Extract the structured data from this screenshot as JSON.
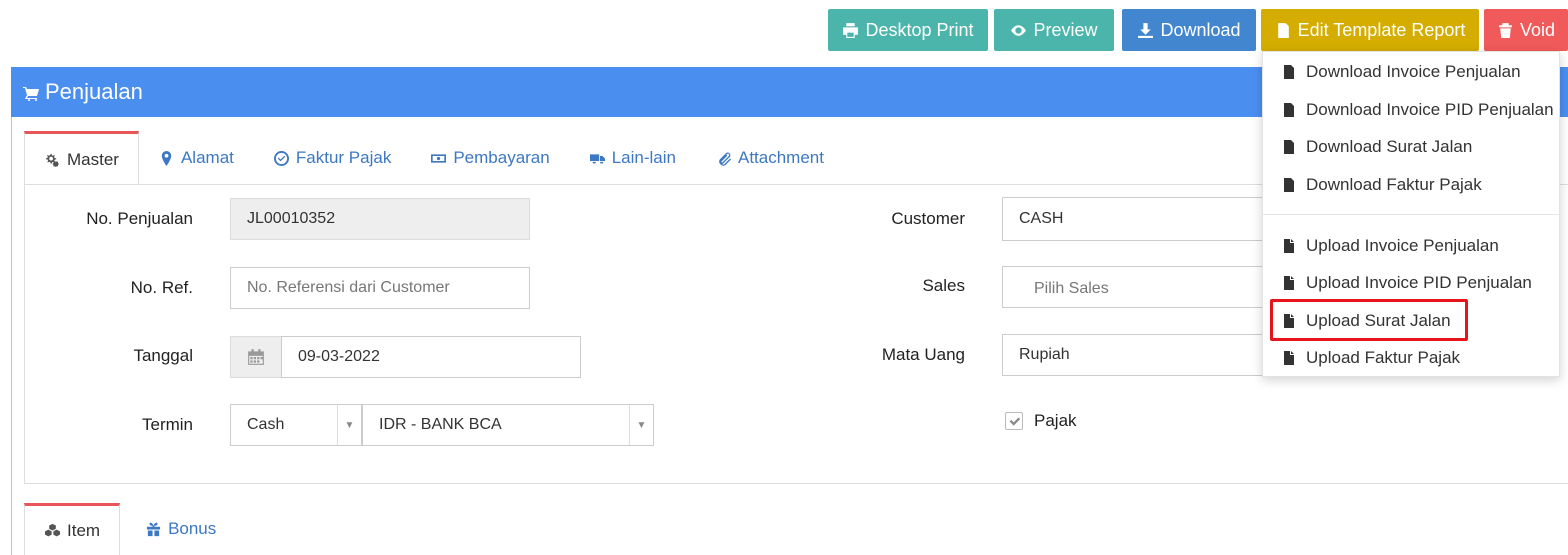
{
  "toolbar": {
    "desktop_print": "Desktop Print",
    "preview": "Preview",
    "download": "Download",
    "edit_template": "Edit Template Report",
    "void": "Void"
  },
  "panel": {
    "title": "Penjualan"
  },
  "tabs": [
    {
      "label": "Master",
      "icon": "gears-icon"
    },
    {
      "label": "Alamat",
      "icon": "map-marker-icon"
    },
    {
      "label": "Faktur Pajak",
      "icon": "check-circle-icon"
    },
    {
      "label": "Pembayaran",
      "icon": "money-icon"
    },
    {
      "label": "Lain-lain",
      "icon": "truck-icon"
    },
    {
      "label": "Attachment",
      "icon": "paperclip-icon"
    }
  ],
  "form": {
    "no_penjualan_label": "No. Penjualan",
    "no_penjualan_value": "JL00010352",
    "no_ref_label": "No. Ref.",
    "no_ref_placeholder": "No. Referensi dari Customer",
    "tanggal_label": "Tanggal",
    "tanggal_value": "09-03-2022",
    "termin_label": "Termin",
    "termin_value": "Cash",
    "bank_value": "IDR - BANK BCA",
    "customer_label": "Customer",
    "customer_value": "CASH",
    "sales_label": "Sales",
    "sales_placeholder": "Pilih Sales",
    "mata_uang_label": "Mata Uang",
    "mata_uang_value": "Rupiah",
    "pajak_label": "Pajak"
  },
  "bottom_tabs": [
    {
      "label": "Item",
      "icon": "cubes-icon"
    },
    {
      "label": "Bonus",
      "icon": "gift-icon"
    }
  ],
  "dropdown": {
    "download_items": [
      "Download Invoice Penjualan",
      "Download Invoice PID Penjualan",
      "Download Surat Jalan",
      "Download Faktur Pajak"
    ],
    "upload_items": [
      "Upload Invoice Penjualan",
      "Upload Invoice PID Penjualan",
      "Upload Surat Jalan",
      "Upload Faktur Pajak"
    ],
    "highlighted": "Upload Surat Jalan"
  },
  "colors": {
    "panel_header": "#4a8ff0",
    "btn_teal": "#4bb5ab",
    "btn_blue": "#4286d0",
    "btn_yellow": "#d4ad00",
    "btn_red": "#f05a5a",
    "highlight_box": "#e8141b",
    "active_tab_border": "#e8565a"
  }
}
